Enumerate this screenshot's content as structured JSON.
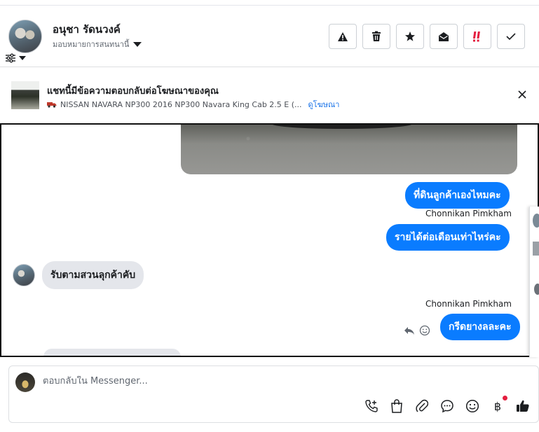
{
  "header": {
    "contact_name": "อนุชา รัดนวงค์",
    "assign_label": "มอบหมายการสนทนานี้",
    "actions": [
      {
        "name": "spam-button",
        "icon": "warning-icon"
      },
      {
        "name": "delete-button",
        "icon": "trash-icon"
      },
      {
        "name": "star-button",
        "icon": "star-icon"
      },
      {
        "name": "mark-unread-button",
        "icon": "envelope-open-icon"
      },
      {
        "name": "follow-up-button",
        "icon": "exclamation-icon"
      },
      {
        "name": "done-button",
        "icon": "check-icon"
      }
    ]
  },
  "ad_banner": {
    "title": "แชทนี้มีข้อความตอบกลับต่อโฆษณาของคุณ",
    "ad_text": "NISSAN NAVARA NP300 2016 NP300 Navara King Cab 2.5 E (...",
    "view_ad_link": "ดูโฆษณา"
  },
  "messages": {
    "out_1": "ที่ดินลูกค้าเองไหมคะ",
    "sender_1": "Chonnikan Pimkham",
    "out_2": "รายได้ต่อเดือนเท่าไหร่คะ",
    "in_1": "รับตามสวนลุกค้าคับ",
    "sender_2": "Chonnikan Pimkham",
    "out_3": "กรีดยางลละคะ"
  },
  "composer": {
    "placeholder": "ตอบกลับใน Messenger...",
    "currency_symbol": "฿"
  },
  "colors": {
    "accent": "#0a7cff",
    "follow_up": "#e41e3f",
    "link": "#1a73e8"
  }
}
